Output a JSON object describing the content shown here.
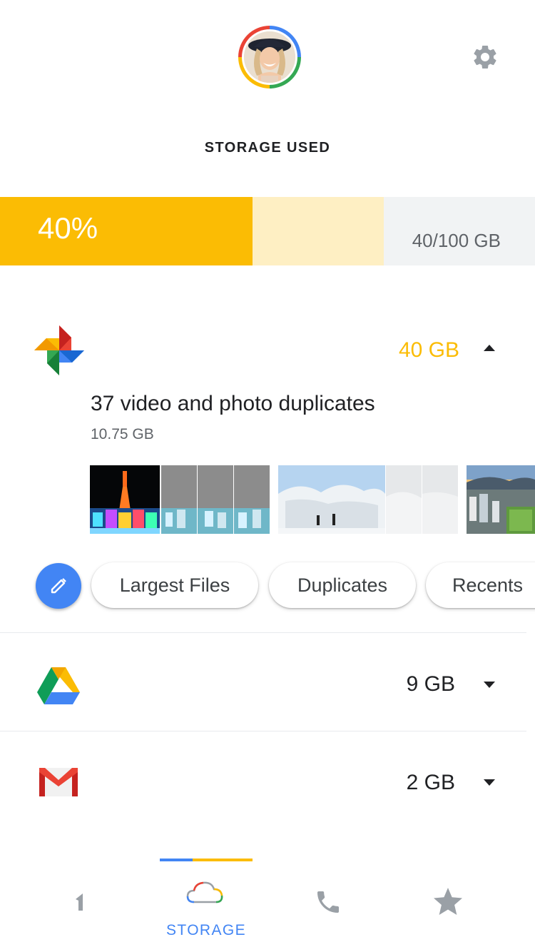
{
  "header": {
    "title": "STORAGE USED",
    "avatar_alt": "profile-avatar",
    "settings_icon": "gear-icon"
  },
  "usage": {
    "percent_label": "40%",
    "total_label": "40/100 GB",
    "used_fraction": 0.4,
    "colors": {
      "used": "#FBBC04",
      "pending": "#FEEFC3",
      "free": "#F1F3F4"
    }
  },
  "sections": [
    {
      "app": "photos",
      "icon": "google-photos-icon",
      "size": "40 GB",
      "expanded": true,
      "size_color": "#FBBC04"
    },
    {
      "app": "drive",
      "icon": "google-drive-icon",
      "size": "9 GB",
      "expanded": false
    },
    {
      "app": "gmail",
      "icon": "gmail-icon",
      "size": "2 GB",
      "expanded": false
    }
  ],
  "photos_detail": {
    "duplicates_title": "37 video and photo duplicates",
    "duplicates_size": "10.75 GB"
  },
  "chips": {
    "edit_icon": "pencil-icon",
    "items": [
      "Largest Files",
      "Duplicates",
      "Recents"
    ]
  },
  "bottom_nav": {
    "active_label": "STORAGE",
    "items": [
      "home-icon",
      "cloud-icon",
      "phone-icon",
      "star-icon"
    ],
    "accent": "#4285F4"
  }
}
